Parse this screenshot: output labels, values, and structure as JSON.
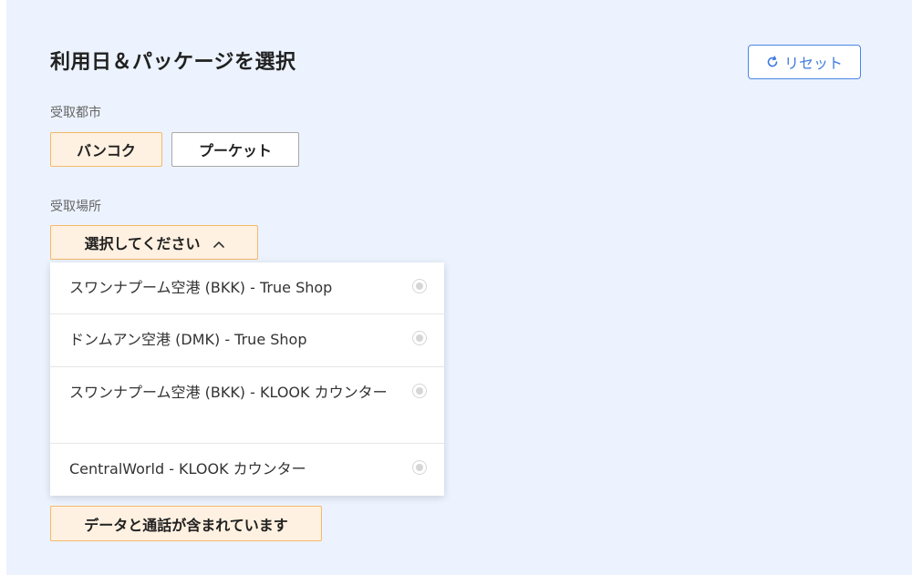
{
  "header": {
    "title": "利用日＆パッケージを選択",
    "reset_label": "リセット"
  },
  "pickup_city": {
    "label": "受取都市",
    "options": [
      {
        "label": "バンコク",
        "selected": true
      },
      {
        "label": "プーケット",
        "selected": false
      }
    ]
  },
  "pickup_location": {
    "label": "受取場所",
    "placeholder": "選択してください",
    "expanded": true,
    "options": [
      {
        "label": "スワンナプーム空港 (BKK) - True Shop"
      },
      {
        "label": "ドンムアン空港 (DMK) - True Shop"
      },
      {
        "label": "スワンナプーム空港 (BKK) - KLOOK カウンター"
      },
      {
        "label": "CentralWorld - KLOOK カウンター"
      }
    ]
  },
  "package": {
    "label": "データと通話が含まれています",
    "selected": true
  },
  "colors": {
    "panel_background": "#ecf3fe",
    "accent_blue": "#4985e6",
    "selected_fill": "#fff1e1",
    "selected_border": "#f5b86a"
  },
  "icons": {
    "reset": "refresh-icon",
    "dropdown": "chevron-up-icon",
    "option": "radio-icon"
  }
}
